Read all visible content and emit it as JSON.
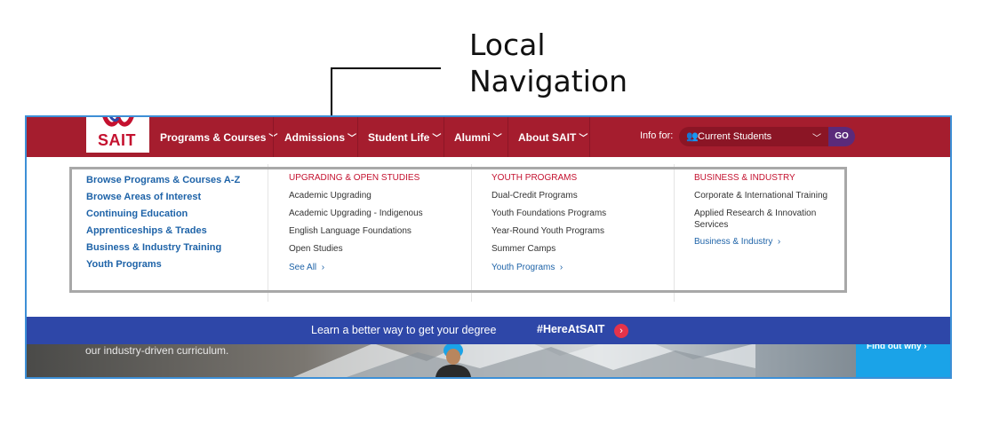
{
  "annotation": {
    "line1": "Local",
    "line2": "Navigation"
  },
  "header": {
    "logo_text": "SAIT",
    "nav": [
      {
        "label": "Programs & Courses"
      },
      {
        "label": "Admissions"
      },
      {
        "label": "Student Life"
      },
      {
        "label": "Alumni"
      },
      {
        "label": "About SAIT"
      }
    ],
    "info_for_label": "Info for:",
    "audience_select_value": "Current Students",
    "go_label": "GO"
  },
  "menu": {
    "main_links": [
      "Browse Programs & Courses A-Z",
      "Browse Areas of Interest",
      "Continuing Education",
      "Apprenticeships & Trades",
      "Business & Industry Training",
      "Youth Programs"
    ],
    "columns": [
      {
        "heading": "UPGRADING & OPEN STUDIES",
        "items": [
          "Academic Upgrading",
          "Academic Upgrading - Indigenous",
          "English Language Foundations",
          "Open Studies"
        ],
        "more": "See All"
      },
      {
        "heading": "YOUTH PROGRAMS",
        "items": [
          "Dual-Credit Programs",
          "Youth Foundations Programs",
          "Year-Round Youth Programs",
          "Summer Camps"
        ],
        "more": "Youth Programs"
      },
      {
        "heading": "BUSINESS & INDUSTRY",
        "items": [
          "Corporate & International Training",
          "Applied Research & Innovation Services"
        ],
        "more": "Business & Industry"
      }
    ]
  },
  "banner": {
    "text": "Learn a better way to get your degree",
    "hashtag": "#HereAtSAIT",
    "caption": "our industry-driven curriculum.",
    "cta": "Find out why"
  },
  "colors": {
    "brand_red": "#a51d2e",
    "link_blue": "#1e63a8",
    "banner_blue": "#2e47a8",
    "cta_blue": "#1aa3e8"
  }
}
